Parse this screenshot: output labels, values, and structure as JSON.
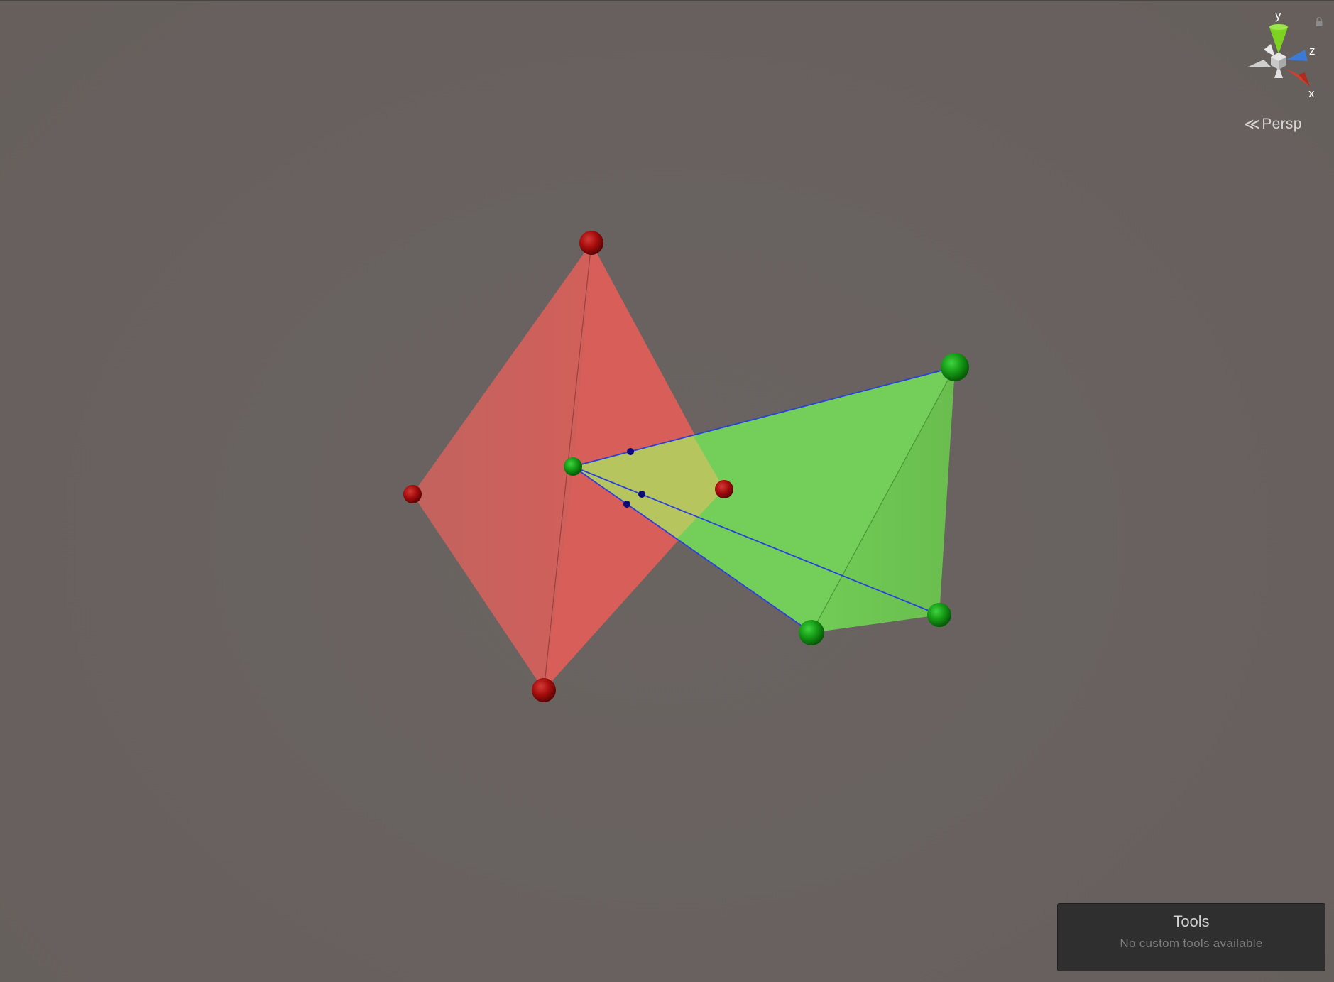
{
  "scene_view": {
    "background": "#686260",
    "gizmo": {
      "axis_labels": {
        "y": "y",
        "z": "z",
        "x": "x"
      },
      "colors": {
        "y": "#7ed321",
        "z": "#3b7bd6",
        "x": "#d0402e",
        "neutral": "#cfcfcf"
      },
      "projection_label": "Persp",
      "lock_icon": "lock-icon"
    },
    "tools_overlay": {
      "title": "Tools",
      "subtitle": "No custom tools available"
    },
    "objects": {
      "red_tetrahedron": {
        "face_color": "#dc5b55",
        "vertex_color": "#b00f0f",
        "vertex_count": 4
      },
      "green_tetrahedron": {
        "face_color": "#73d556",
        "vertex_color": "#17a317",
        "edge_color": "#2a3fe0",
        "vertex_count": 4
      }
    }
  }
}
